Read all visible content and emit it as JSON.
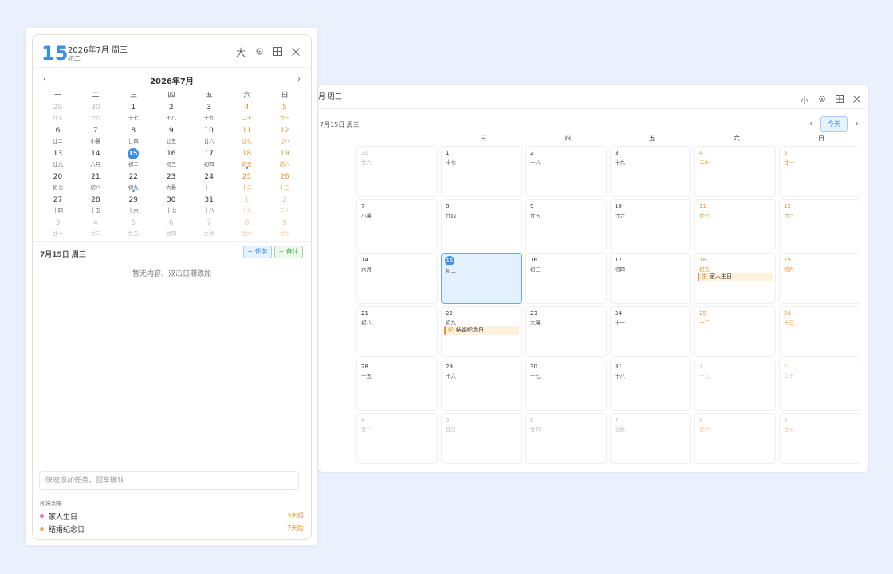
{
  "big": {
    "title_date": "月 周三",
    "tools": {
      "size_label": "小",
      "settings_icon": "gear-icon",
      "grid_icon": "grid-icon",
      "close_icon": "close-icon"
    },
    "selected_date": "7月15日 周三",
    "prev_icon": "chevron-left-icon",
    "today_label": "今天",
    "next_icon": "chevron-right-icon",
    "weekdays": [
      "二",
      "三",
      "四",
      "五",
      "六",
      "日"
    ],
    "rows": [
      [
        {
          "d": "30",
          "l": "廿六",
          "dim": true
        },
        {
          "d": "1",
          "l": "十七"
        },
        {
          "d": "2",
          "l": "十八"
        },
        {
          "d": "3",
          "l": "十九"
        },
        {
          "d": "4",
          "l": "二十",
          "we": true
        },
        {
          "d": "5",
          "l": "廿一",
          "we": true
        }
      ],
      [
        {
          "d": "7",
          "l": "小暑"
        },
        {
          "d": "8",
          "l": "廿四"
        },
        {
          "d": "9",
          "l": "廿五"
        },
        {
          "d": "10",
          "l": "廿六"
        },
        {
          "d": "11",
          "l": "廿七",
          "we": true
        },
        {
          "d": "12",
          "l": "廿八",
          "we": true
        }
      ],
      [
        {
          "d": "14",
          "l": "六月"
        },
        {
          "d": "15",
          "l": "初二",
          "today": true
        },
        {
          "d": "16",
          "l": "初三"
        },
        {
          "d": "17",
          "l": "初四"
        },
        {
          "d": "18",
          "l": "初五",
          "we": true,
          "ev": {
            "tag": "生",
            "text": "家人生日"
          }
        },
        {
          "d": "19",
          "l": "初六",
          "we": true
        }
      ],
      [
        {
          "d": "21",
          "l": "初八"
        },
        {
          "d": "22",
          "l": "初九",
          "ev": {
            "tag": "纪",
            "text": "结婚纪念日"
          }
        },
        {
          "d": "23",
          "l": "大暑"
        },
        {
          "d": "24",
          "l": "十一"
        },
        {
          "d": "25",
          "l": "十二",
          "we": true
        },
        {
          "d": "26",
          "l": "十三",
          "we": true
        }
      ],
      [
        {
          "d": "28",
          "l": "十五"
        },
        {
          "d": "29",
          "l": "十六"
        },
        {
          "d": "30",
          "l": "十七"
        },
        {
          "d": "31",
          "l": "十八"
        },
        {
          "d": "1",
          "l": "十九",
          "we": true,
          "dim": true
        },
        {
          "d": "2",
          "l": "二十",
          "we": true,
          "dim": true
        }
      ],
      [
        {
          "d": "4",
          "l": "廿二",
          "dim": true
        },
        {
          "d": "5",
          "l": "廿三",
          "dim": true
        },
        {
          "d": "6",
          "l": "廿四",
          "dim": true
        },
        {
          "d": "7",
          "l": "立秋",
          "dim": true
        },
        {
          "d": "8",
          "l": "廿六",
          "we": true,
          "dim": true
        },
        {
          "d": "9",
          "l": "廿七",
          "we": true,
          "dim": true
        }
      ]
    ]
  },
  "small": {
    "day": "15",
    "date": "2026年7月 周三",
    "lunar": "初二",
    "tools": {
      "size_label": "大",
      "settings_icon": "gear-icon",
      "grid_icon": "grid-icon",
      "close_icon": "close-icon"
    },
    "prev": "‹",
    "next": "›",
    "month_title": "2026年7月",
    "weekdays": [
      "一",
      "二",
      "三",
      "四",
      "五",
      "六",
      "日"
    ],
    "rows": [
      [
        {
          "d": "29",
          "l": "廿五",
          "dim": true
        },
        {
          "d": "30",
          "l": "廿六",
          "dim": true
        },
        {
          "d": "1",
          "l": "十七"
        },
        {
          "d": "2",
          "l": "十八"
        },
        {
          "d": "3",
          "l": "十九"
        },
        {
          "d": "4",
          "l": "二十",
          "we": true
        },
        {
          "d": "5",
          "l": "廿一",
          "we": true
        }
      ],
      [
        {
          "d": "6",
          "l": "廿二"
        },
        {
          "d": "7",
          "l": "小暑"
        },
        {
          "d": "8",
          "l": "廿四"
        },
        {
          "d": "9",
          "l": "廿五"
        },
        {
          "d": "10",
          "l": "廿六"
        },
        {
          "d": "11",
          "l": "廿七",
          "we": true
        },
        {
          "d": "12",
          "l": "廿八",
          "we": true
        }
      ],
      [
        {
          "d": "13",
          "l": "廿九"
        },
        {
          "d": "14",
          "l": "六月"
        },
        {
          "d": "15",
          "l": "初二",
          "today": true
        },
        {
          "d": "16",
          "l": "初三"
        },
        {
          "d": "17",
          "l": "初四"
        },
        {
          "d": "18",
          "l": "初五",
          "we": true,
          "dot": true
        },
        {
          "d": "19",
          "l": "初六",
          "we": true
        }
      ],
      [
        {
          "d": "20",
          "l": "初七"
        },
        {
          "d": "21",
          "l": "初八"
        },
        {
          "d": "22",
          "l": "初九",
          "dot": true
        },
        {
          "d": "23",
          "l": "大暑"
        },
        {
          "d": "24",
          "l": "十一"
        },
        {
          "d": "25",
          "l": "十二",
          "we": true
        },
        {
          "d": "26",
          "l": "十三",
          "we": true
        }
      ],
      [
        {
          "d": "27",
          "l": "十四"
        },
        {
          "d": "28",
          "l": "十五"
        },
        {
          "d": "29",
          "l": "十六"
        },
        {
          "d": "30",
          "l": "十七"
        },
        {
          "d": "31",
          "l": "十八"
        },
        {
          "d": "1",
          "l": "十九",
          "we": true,
          "dim": true
        },
        {
          "d": "2",
          "l": "二十",
          "we": true,
          "dim": true
        }
      ],
      [
        {
          "d": "3",
          "l": "廿一",
          "dim": true
        },
        {
          "d": "4",
          "l": "廿二",
          "dim": true
        },
        {
          "d": "5",
          "l": "廿三",
          "dim": true
        },
        {
          "d": "6",
          "l": "廿四",
          "dim": true
        },
        {
          "d": "7",
          "l": "立秋",
          "dim": true
        },
        {
          "d": "8",
          "l": "廿六",
          "we": true,
          "dim": true
        },
        {
          "d": "9",
          "l": "廿七",
          "we": true,
          "dim": true
        }
      ]
    ],
    "selected_date": "7月15日 周三",
    "add_task": "+ 任务",
    "add_note": "+ 备注",
    "empty_text": "暂无内容，双击日期添加",
    "quick_input_placeholder": "快速添加任务，回车确认",
    "upcoming_title": "即将到来",
    "upcoming": [
      {
        "name": "家人生日",
        "days": "3天后",
        "color": "#e87aa0"
      },
      {
        "name": "结婚纪念日",
        "days": "7天后",
        "color": "#f0a860"
      }
    ]
  }
}
